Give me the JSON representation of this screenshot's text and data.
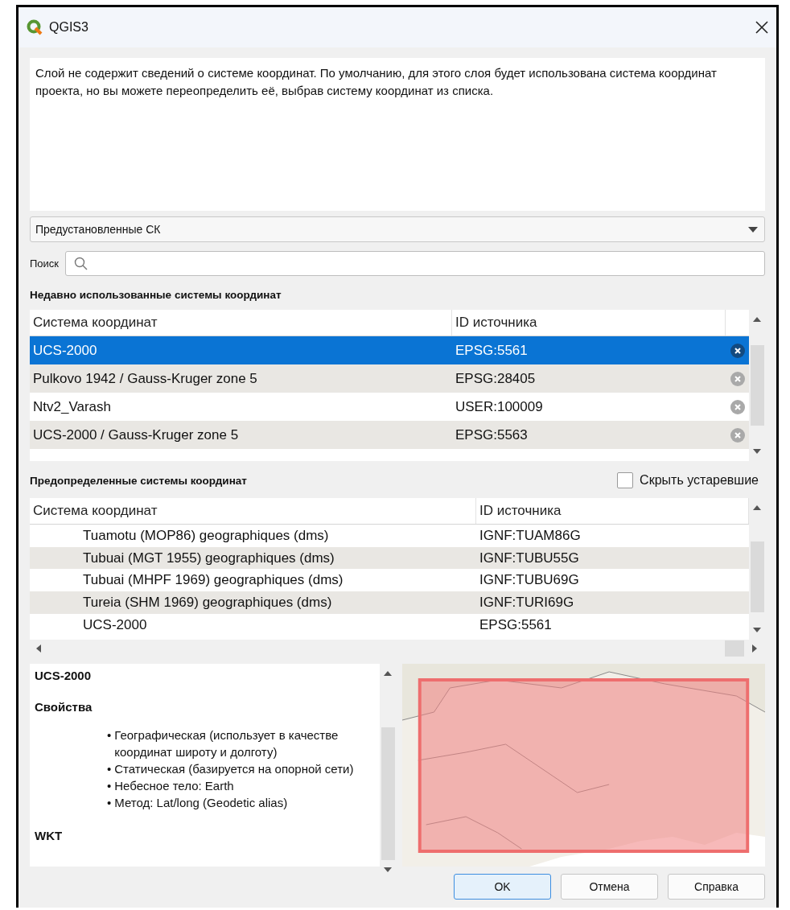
{
  "window": {
    "title": "QGIS3"
  },
  "message": "Слой не содержит сведений о системе координат. По умолчанию, для этого слоя будет использована система координат проекта, но вы можете переопределить её, выбрав систему координат из списка.",
  "crs_filter": {
    "value": "Предустановленные СК"
  },
  "search": {
    "label": "Поиск"
  },
  "recent": {
    "heading": "Недавно использованные системы координат",
    "columns": [
      "Система координат",
      "ID источника"
    ],
    "rows": [
      {
        "name": "UCS-2000",
        "id": "EPSG:5561",
        "selected": true
      },
      {
        "name": "Pulkovo 1942 / Gauss-Kruger zone 5",
        "id": "EPSG:28405",
        "selected": false
      },
      {
        "name": "Ntv2_Varash",
        "id": "USER:100009",
        "selected": false
      },
      {
        "name": "UCS-2000 / Gauss-Kruger zone 5",
        "id": "EPSG:5563",
        "selected": false
      }
    ]
  },
  "predefined": {
    "heading": "Предопределенные системы координат",
    "hide_deprecated": {
      "label": "Скрыть устаревшие",
      "checked": false
    },
    "columns": [
      "Система координат",
      "ID источника"
    ],
    "rows": [
      {
        "name": "Tuamotu (MOP86) geographiques (dms)",
        "id": "IGNF:TUAM86G",
        "selected": false
      },
      {
        "name": "Tubuai (MGT 1955) geographiques (dms)",
        "id": "IGNF:TUBU55G",
        "selected": false
      },
      {
        "name": "Tubuai (MHPF 1969) geographiques (dms)",
        "id": "IGNF:TUBU69G",
        "selected": false
      },
      {
        "name": "Tureia (SHM 1969) geographiques (dms)",
        "id": "IGNF:TURI69G",
        "selected": false
      },
      {
        "name": "UCS-2000",
        "id": "EPSG:5561",
        "selected": false
      }
    ]
  },
  "details": {
    "title": "UCS-2000",
    "properties_heading": "Свойства",
    "properties": [
      {
        "marker": "•",
        "text": "Географическая (использует в качестве координат широту и долготу)"
      },
      {
        "marker": "•",
        "text": "Статическая (базируется на опорной сети)"
      },
      {
        "marker": "•",
        "text": "Небесное тело: Earth"
      },
      {
        "marker": "•",
        "text": "Метод: Lat/long (Geodetic alias)"
      }
    ],
    "wkt_heading": "WKT"
  },
  "buttons": [
    {
      "label": "OK",
      "default": true
    },
    {
      "label": "Отмена",
      "default": false
    },
    {
      "label": "Справка",
      "default": false
    }
  ]
}
